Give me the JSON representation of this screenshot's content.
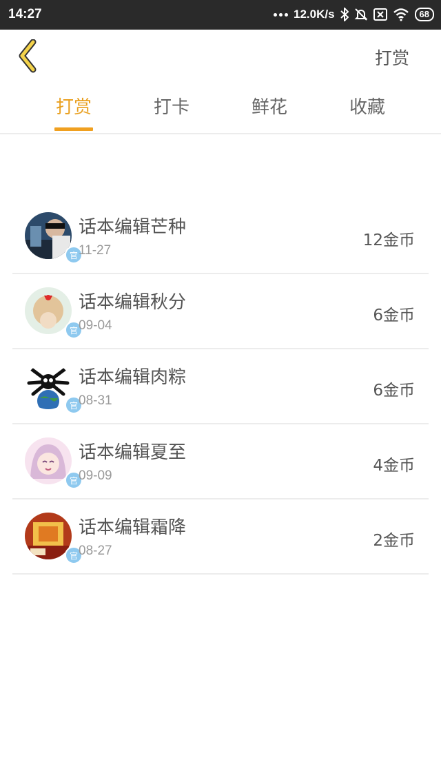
{
  "status_bar": {
    "time": "14:27",
    "speed": "12.0K/s",
    "battery": "68"
  },
  "header": {
    "back_icon": "chevron-left-icon",
    "action_label": "打赏",
    "accent_color": "#e9a020"
  },
  "tabs": [
    {
      "label": "打赏",
      "active": true
    },
    {
      "label": "打卡",
      "active": false
    },
    {
      "label": "鲜花",
      "active": false
    },
    {
      "label": "收藏",
      "active": false
    }
  ],
  "records": [
    {
      "name": "话本编辑芒种",
      "date": "11-27",
      "amount": "12金币",
      "badge": "官"
    },
    {
      "name": "话本编辑秋分",
      "date": "09-04",
      "amount": "6金币",
      "badge": "官"
    },
    {
      "name": "话本编辑肉粽",
      "date": "08-31",
      "amount": "6金币",
      "badge": "官"
    },
    {
      "name": "话本编辑夏至",
      "date": "09-09",
      "amount": "4金币",
      "badge": "官"
    },
    {
      "name": "话本编辑霜降",
      "date": "08-27",
      "amount": "2金币",
      "badge": "官"
    }
  ]
}
